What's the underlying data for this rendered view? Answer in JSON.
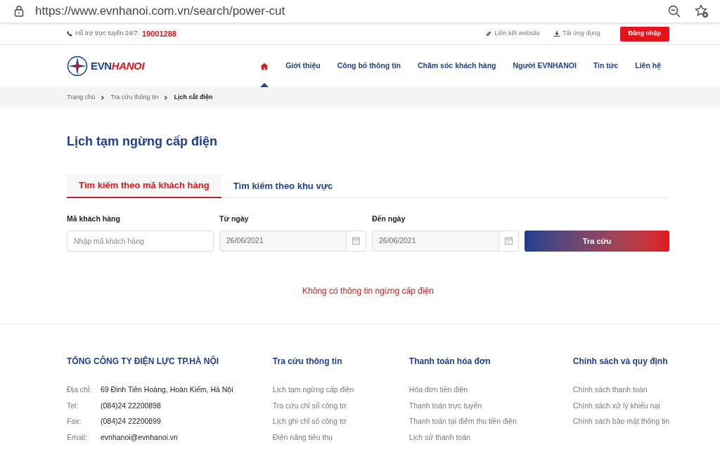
{
  "browser": {
    "url": "https://www.evnhanoi.com.vn/search/power-cut"
  },
  "topbar": {
    "support_label": "Hỗ trợ trực tuyến 24/7:",
    "hotline": "19001288",
    "links": [
      "Liên kết website",
      "Tải ứng dụng"
    ],
    "login": "Đăng nhập"
  },
  "logo": {
    "part_1": "EVN",
    "part_2": "HANOI"
  },
  "nav": [
    {
      "kind": "home",
      "selected": true
    },
    {
      "kind": "text",
      "label": "Giới thiệu",
      "selected": false
    },
    {
      "kind": "text",
      "label": "Công bố thông tin",
      "selected": false
    },
    {
      "kind": "text",
      "label": "Chăm sóc khách hàng",
      "selected": false
    },
    {
      "kind": "text",
      "label": "Người EVNHANOI",
      "selected": false
    },
    {
      "kind": "text",
      "label": "Tin tức",
      "selected": false
    },
    {
      "kind": "text",
      "label": "Liên hệ",
      "selected": false
    }
  ],
  "breadcrumb": [
    "Trang chủ",
    "Tra cứu thông tin",
    "Lịch cắt điện"
  ],
  "title": "Lịch tạm ngừng cấp điện",
  "tabs": [
    {
      "label": "Tìm kiếm theo mã khách hàng",
      "selected": true
    },
    {
      "label": "Tìm kiếm theo khu vực",
      "selected": false
    }
  ],
  "form": {
    "fields": [
      {
        "kind": "text",
        "label": "Mã khách hàng",
        "placeholder": "Nhập mã khách hàng"
      },
      {
        "kind": "date",
        "label": "Từ ngày",
        "value": "26/06/2021"
      },
      {
        "kind": "date",
        "label": "Đến ngày",
        "value": "26/06/2021"
      }
    ],
    "submit": "Tra cứu"
  },
  "message": "Không có thông tin ngừng cấp điện",
  "footer": {
    "company": {
      "heading": "TỔNG CÔNG TY ĐIỆN LỰC TP.HÀ NỘI",
      "rows": [
        {
          "label": "Địa chỉ:",
          "value": "69 Đinh Tiên Hoàng, Hoàn Kiếm, Hà Nội"
        },
        {
          "label": "Tel:",
          "value": "(084)24 22200898"
        },
        {
          "label": "Fax:",
          "value": "(084)24 22200899"
        },
        {
          "label": "Email:",
          "value": "evnhanoi@evnhanoi.vn"
        }
      ]
    },
    "columns": [
      {
        "heading": "Tra cứu thông tin",
        "links": [
          "Lịch tạm ngừng cấp điện",
          "Tra cứu chỉ số công tơ",
          "Lịch ghi chỉ số công tơ",
          "Điện năng tiêu thụ"
        ]
      },
      {
        "heading": "Thanh toán hóa đơn",
        "links": [
          "Hóa đơn tiền điện",
          "Thanh toán trực tuyến",
          "Thanh toán tại điểm thu tiền điện",
          "Lịch sử thanh toán"
        ]
      },
      {
        "heading": "Chính sách và quy định",
        "links": [
          "Chính sách thanh toán",
          "Chính sách xử lý khiếu nại",
          "Chính sách bảo mật thông tin"
        ]
      }
    ]
  }
}
